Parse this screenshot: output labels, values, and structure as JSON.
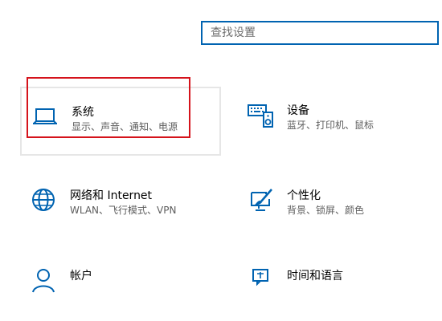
{
  "search": {
    "placeholder": "查找设置"
  },
  "tiles": [
    {
      "title": "系统",
      "desc": "显示、声音、通知、电源",
      "icon": "laptop-icon"
    },
    {
      "title": "设备",
      "desc": "蓝牙、打印机、鼠标",
      "icon": "keyboard-speaker-icon"
    },
    {
      "title": "网络和 Internet",
      "desc": "WLAN、飞行模式、VPN",
      "icon": "globe-icon"
    },
    {
      "title": "个性化",
      "desc": "背景、锁屏、颜色",
      "icon": "paint-brush-icon"
    },
    {
      "title": "帐户",
      "desc": "",
      "icon": "person-icon"
    },
    {
      "title": "时间和语言",
      "desc": "",
      "icon": "time-language-icon"
    }
  ],
  "colors": {
    "accent": "#0063b1",
    "highlight": "#d5131b"
  }
}
